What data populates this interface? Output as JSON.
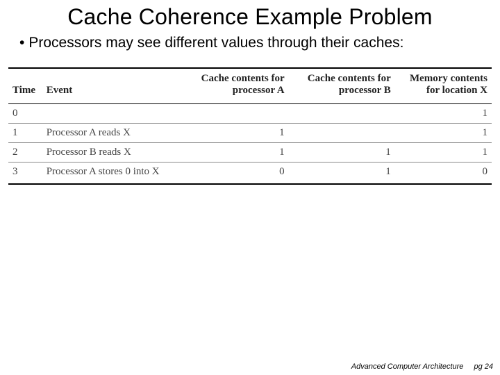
{
  "title": "Cache Coherence Example Problem",
  "bullet_dot": "•",
  "bullet_text": "Processors may see different values through their caches:",
  "chart_data": {
    "type": "table",
    "columns": [
      "Time",
      "Event",
      "Cache contents for processor A",
      "Cache contents for processor B",
      "Memory contents for location X"
    ],
    "rows": [
      {
        "time": "0",
        "event": "",
        "a": "",
        "b": "",
        "m": "1"
      },
      {
        "time": "1",
        "event": "Processor A reads X",
        "a": "1",
        "b": "",
        "m": "1"
      },
      {
        "time": "2",
        "event": "Processor B reads X",
        "a": "1",
        "b": "1",
        "m": "1"
      },
      {
        "time": "3",
        "event": "Processor A stores 0 into X",
        "a": "0",
        "b": "1",
        "m": "0"
      }
    ]
  },
  "footer_course": "Advanced Computer Architecture",
  "footer_page": "pg 24"
}
